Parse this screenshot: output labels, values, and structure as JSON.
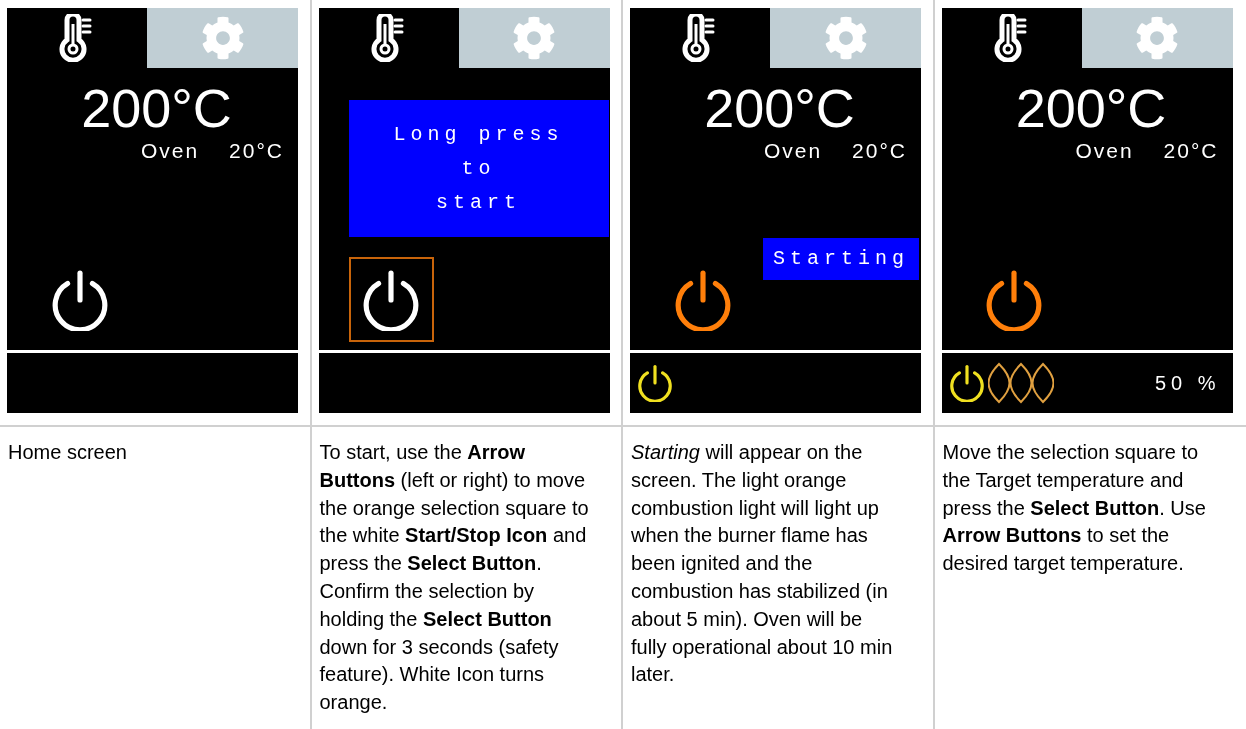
{
  "steps": [
    {
      "screen": {
        "tabs": [
          {
            "kind": "temperature",
            "selected": true
          },
          {
            "kind": "settings",
            "selected": false
          }
        ],
        "target": "200°C",
        "oven_label": "Oven",
        "oven_temp": "20°C",
        "power": {
          "on": false,
          "selected": false
        }
      },
      "caption": "Home screen"
    },
    {
      "screen": {
        "tabs": [
          {
            "kind": "temperature",
            "selected": true
          },
          {
            "kind": "settings",
            "selected": false
          }
        ],
        "message": {
          "kind": "popup",
          "lines": [
            "Long press",
            "to",
            "start"
          ]
        },
        "power": {
          "on": false,
          "selected": true
        }
      },
      "caption": "To start, use the **Arrow Buttons** (left or right) to move the orange selection square to the white **Start/Stop Icon** and press the **Select Button**. Confirm the selection by holding the **Select Button** down for 3 seconds (safety feature). White Icon turns orange."
    },
    {
      "screen": {
        "tabs": [
          {
            "kind": "temperature",
            "selected": true
          },
          {
            "kind": "settings",
            "selected": false
          }
        ],
        "target": "200°C",
        "oven_label": "Oven",
        "oven_temp": "20°C",
        "message": {
          "kind": "banner",
          "lines": [
            "Starting"
          ]
        },
        "power": {
          "on": true,
          "selected": false
        },
        "status": {
          "indicators": [
            {
              "kind": "burner"
            }
          ]
        }
      },
      "caption": "*Starting* will appear on the screen. The light orange combustion light will light up when the burner flame has been ignited and the combustion has stabilized (in about 5 min). Oven will be fully operational about 10 min later."
    },
    {
      "screen": {
        "tabs": [
          {
            "kind": "temperature",
            "selected": true
          },
          {
            "kind": "settings",
            "selected": false
          }
        ],
        "target": "200°C",
        "oven_label": "Oven",
        "oven_temp": "20°C",
        "power": {
          "on": true,
          "selected": false
        },
        "status": {
          "indicators": [
            {
              "kind": "burner"
            },
            {
              "kind": "flame"
            }
          ],
          "reading": "50 %"
        }
      },
      "caption": "Move the selection square to the Target temperature and press the **Select Button**. Use **Arrow Buttons** to set the desired target temperature."
    }
  ]
}
